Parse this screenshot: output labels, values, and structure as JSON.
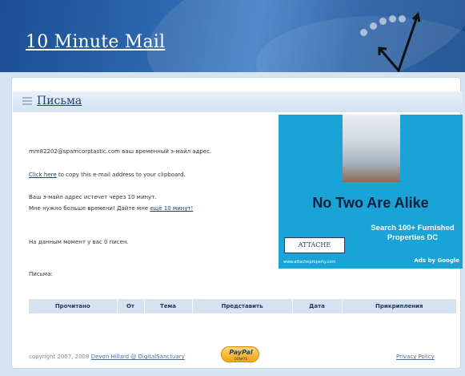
{
  "header": {
    "logo_text": "10 Minute Mail"
  },
  "section": {
    "title": "Письма"
  },
  "info": {
    "address_line": "mm82202@spamcorptastic.com ваш временный э-майл адрес.",
    "copy_link": "Click here",
    "copy_rest": "to copy this e-mail address to your clipboard.",
    "expire_line": "Ваш э-майл адрес истечет через 10 минут.",
    "more_time_text": "Мне нужно больше времени! Дайте мне",
    "more_time_link": "ещё 10 минут!",
    "count_line": "На данным момент у вас 0 писен.",
    "letters_label": "Письма:"
  },
  "ad": {
    "headline": "No Two Are Alike",
    "sub_line1": "Search 100+ Furnished",
    "sub_line2": "Properties DC",
    "brand": "ATTACHE",
    "url": "www.attacheproperty.com",
    "ads_by": "Ads by Google",
    "color_bg": "#1aa3d7"
  },
  "table": {
    "columns": [
      "Прочитано",
      "От",
      "Тема",
      "Представить",
      "Дата",
      "Прикрипления"
    ]
  },
  "footer": {
    "copyright": "copyright 2007, 2008",
    "author_link": "Devon Hillard @ DigitalSanctuary",
    "paypal_label": "PayPal",
    "donate_label": "DONATE",
    "privacy_link": "Privacy Policy"
  },
  "colors": {
    "header_blue": "#1f5aa2",
    "link_blue": "#1e3f73",
    "page_bg": "#d7e3ef"
  }
}
